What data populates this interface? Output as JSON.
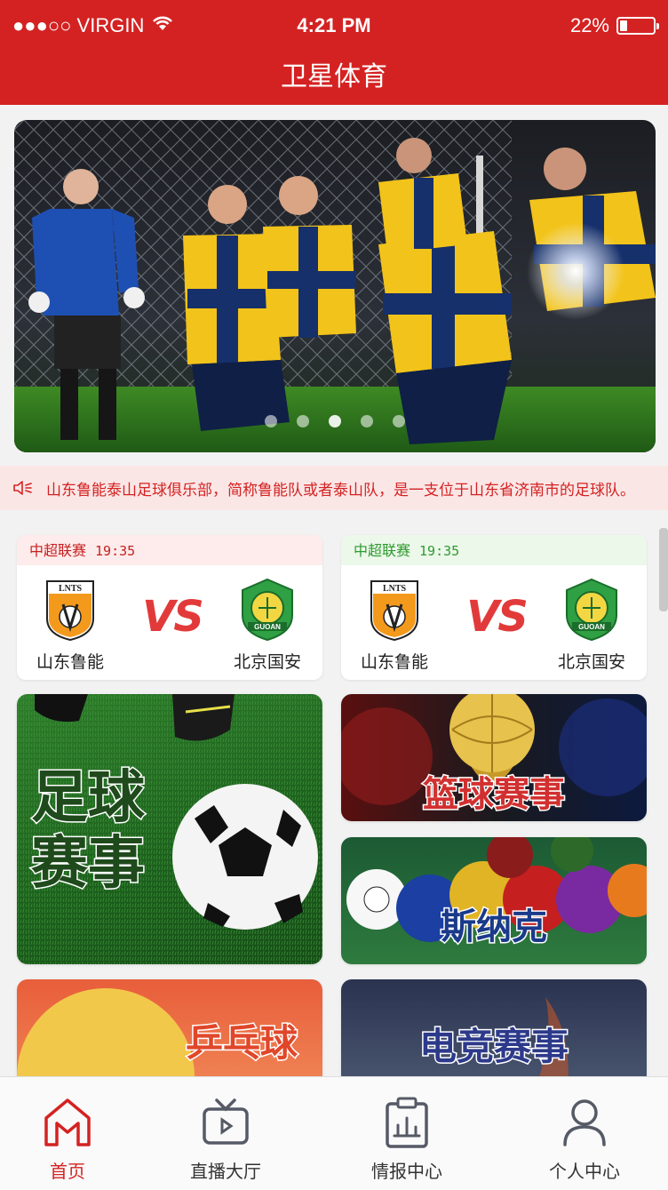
{
  "status_bar": {
    "carrier": "●●●○○ VIRGIN",
    "time": "4:21 PM",
    "battery_text": "22%",
    "battery_level": 0.22
  },
  "app": {
    "title": "卫星体育"
  },
  "banner": {
    "slides": 5,
    "active_slide": 3
  },
  "notice": {
    "icon": "speaker-icon",
    "text": "山东鲁能泰山足球俱乐部，简称鲁能队或者泰山队，是一支位于山东省济南市的足球队。"
  },
  "matches": [
    {
      "league": "中超联赛",
      "time": "19:35",
      "home": "山东鲁能",
      "away": "北京国安",
      "vs": "VS",
      "home_logo_text": "LNTS",
      "away_logo_text": "GUOAN"
    },
    {
      "league": "中超联赛",
      "time": "19:35",
      "home": "山东鲁能",
      "away": "北京国安",
      "vs": "VS",
      "home_logo_text": "LNTS",
      "away_logo_text": "GUOAN"
    }
  ],
  "categories": {
    "football": "足球\n赛事",
    "basketball": "篮球赛事",
    "snooker": "斯纳克",
    "pingpong": "乒乓球",
    "esports": "电竞赛事"
  },
  "tabs": [
    {
      "label": "首页",
      "icon": "home-icon",
      "active": true
    },
    {
      "label": "直播大厅",
      "icon": "tv-icon",
      "active": false
    },
    {
      "label": "情报中心",
      "icon": "clipboard-chart-icon",
      "active": false
    },
    {
      "label": "个人中心",
      "icon": "user-icon",
      "active": false
    }
  ],
  "colors": {
    "brand_red": "#d42222",
    "league_green": "#2f9a2f"
  }
}
